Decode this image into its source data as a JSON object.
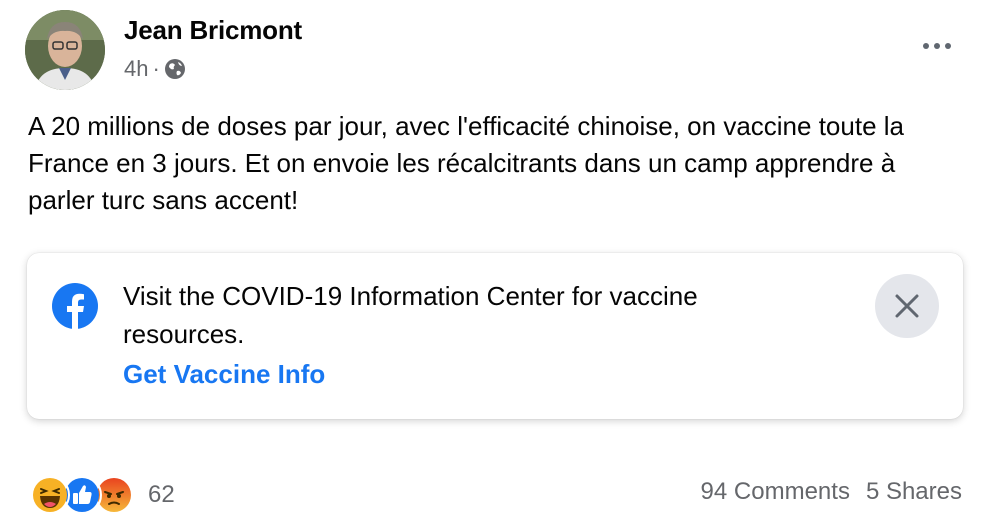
{
  "post": {
    "author": "Jean Bricmont",
    "time": "4h",
    "separator": "·",
    "audience_icon": "globe-icon",
    "more_icon": "more-options-icon",
    "text": "A 20 millions de doses par jour, avec l'efficacité chinoise, on vaccine toute la France en 3 jours. Et on envoie les récalcitrants dans un camp apprendre à parler turc sans accent!"
  },
  "info_card": {
    "icon": "facebook-logo-icon",
    "text": "Visit the COVID-19 Information Center for vaccine resources.",
    "link": "Get Vaccine Info",
    "close_icon": "close-icon",
    "accent_color": "#1877f2"
  },
  "footer": {
    "reactions": [
      "haha",
      "like",
      "angry"
    ],
    "reaction_count": "62",
    "comments": "94 Comments",
    "shares": "5 Shares"
  }
}
